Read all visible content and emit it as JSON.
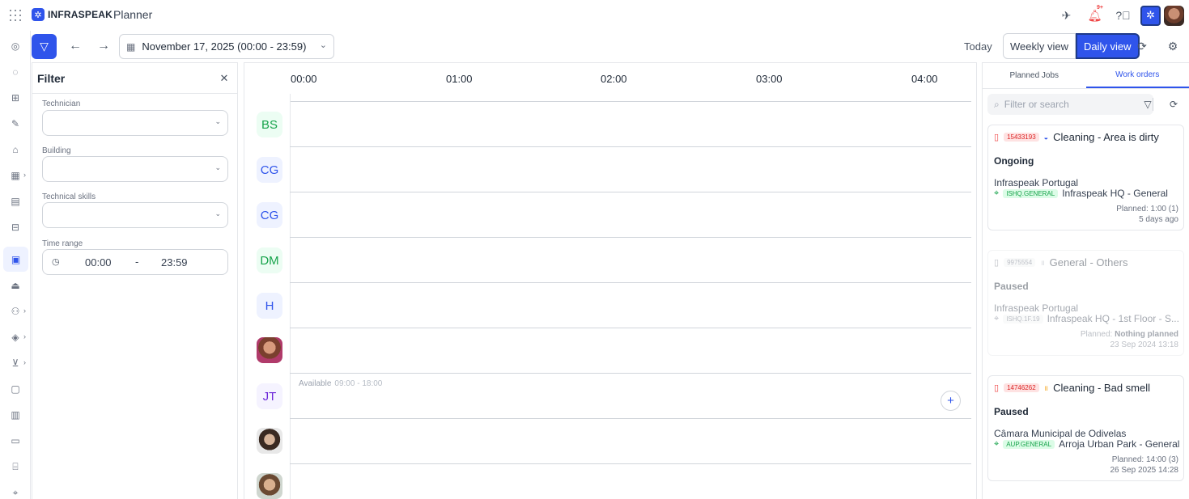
{
  "app": {
    "logo_text": "INFRASPEAK",
    "title": "Planner"
  },
  "top_right": {
    "notif_badge": "9+"
  },
  "toolbar": {
    "date_range": "November 17, 2025 (00:00 - 23:59)",
    "today_label": "Today",
    "weekly_label": "Weekly view",
    "daily_label": "Daily view"
  },
  "filter": {
    "title": "Filter",
    "technician_label": "Technician",
    "building_label": "Building",
    "skills_label": "Technical skills",
    "time_range_label": "Time range",
    "time_from": "00:00",
    "time_sep": "-",
    "time_to": "23:59"
  },
  "timeline": {
    "hours": [
      "00:00",
      "01:00",
      "02:00",
      "03:00",
      "04:00"
    ],
    "rows": [
      {
        "initials": "BS",
        "style": "green"
      },
      {
        "initials": "CG",
        "style": "blue"
      },
      {
        "initials": "CG",
        "style": "blue"
      },
      {
        "initials": "DM",
        "style": "green"
      },
      {
        "initials": "H",
        "style": "blue"
      },
      {
        "initials": "",
        "style": "photo1"
      },
      {
        "initials": "JT",
        "style": "purple"
      },
      {
        "initials": "",
        "style": "photo2"
      },
      {
        "initials": "",
        "style": "photo3"
      }
    ],
    "available_label": "Available",
    "available_hours": "09:00 - 18:00"
  },
  "right_panel": {
    "tabs": [
      "Planned Jobs",
      "Work orders"
    ],
    "active_tab": "Work orders",
    "search_placeholder": "Filter or search",
    "work_orders": [
      {
        "id": "15433193",
        "title": "Cleaning - Area is dirty",
        "status": "Ongoing",
        "client": "Infraspeak Portugal",
        "loc_code": "ISHQ.GENERAL",
        "location": "Infraspeak HQ - General",
        "planned_label": "Planned:",
        "planned_value": "1:00 (1)",
        "ago": "5 days ago"
      },
      {
        "id": "9975554",
        "title": "General - Others",
        "status": "Paused",
        "client": "Infraspeak Portugal",
        "loc_code": "ISHQ.1F.19",
        "location": "Infraspeak HQ - 1st Floor - S...",
        "planned_label": "Planned:",
        "planned_value": "Nothing planned",
        "ago": "23 Sep 2024 13:18"
      },
      {
        "id": "14746262",
        "title": "Cleaning - Bad smell",
        "status": "Paused",
        "client": "Câmara Municipal de Odivelas",
        "loc_code": "AUP.GENERAL",
        "location": "Arroja Urban Park - General",
        "planned_label": "Planned:",
        "planned_value": "14:00 (3)",
        "ago": "26 Sep 2025 14:28"
      }
    ]
  },
  "colors": {
    "accent": "#2f54eb",
    "danger": "#ef4444",
    "success": "#16a34a"
  }
}
